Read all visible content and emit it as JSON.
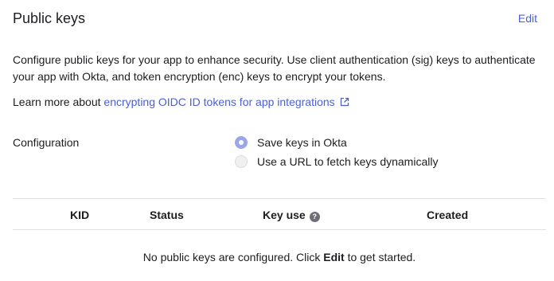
{
  "section": {
    "title": "Public keys",
    "edit_label": "Edit"
  },
  "description": "Configure public keys for your app to enhance security. Use client authentication (sig) keys to authenticate your app with Okta, and token encryption (enc) keys to encrypt your tokens.",
  "learn_more": {
    "prefix": "Learn more about ",
    "link_text": "encrypting OIDC ID tokens for app integrations",
    "icon": "external-link-icon"
  },
  "configuration": {
    "label": "Configuration",
    "options": [
      {
        "label": "Save keys in Okta",
        "selected": true
      },
      {
        "label": "Use a URL to fetch keys dynamically",
        "selected": false
      }
    ]
  },
  "table": {
    "columns": [
      "KID",
      "Status",
      "Key use",
      "Created"
    ],
    "key_use_help_icon": "help-icon",
    "empty_message": {
      "before": "No public keys are configured. Click ",
      "bold": "Edit",
      "after": " to get started."
    }
  },
  "colors": {
    "link": "#4b5fd6",
    "text": "#1d1d21",
    "divider": "#e1e1e4"
  }
}
